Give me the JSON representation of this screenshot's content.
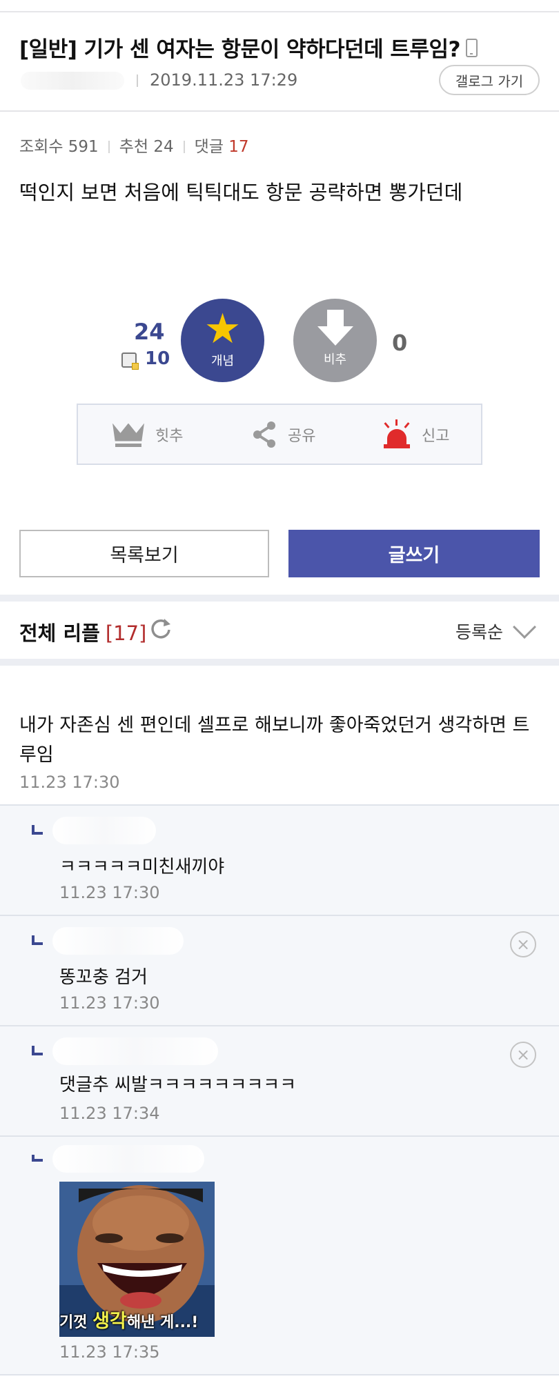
{
  "post": {
    "title": "[일반] 기가 센 여자는 항문이 약하다던데 트루임?",
    "date": "2019.11.23 17:29",
    "gallog_button": "갤로그 가기",
    "views_label": "조회수 591",
    "recommend_label": "추천 24",
    "comments_label": "댓글",
    "comments_count": "17",
    "body": "떡인지 보면 처음에 틱틱대도 항문 공략하면 뽕가던데"
  },
  "votes": {
    "up_count": "24",
    "fix_count": "10",
    "up_label": "개념",
    "down_label": "비추",
    "down_count": "0"
  },
  "actions": {
    "hit": "힛추",
    "share": "공유",
    "report": "신고"
  },
  "buttons": {
    "list": "목록보기",
    "write": "글쓰기"
  },
  "replies_header": {
    "title": "전체 리플",
    "count": "[17]",
    "sort": "등록순"
  },
  "comment": {
    "text": "내가 자존심 센 편인데 셀프로 해보니까 좋아죽었던거 생각하면 트루임",
    "date": "11.23 17:30"
  },
  "replies": [
    {
      "text": "ㅋㅋㅋㅋㅋ미친새끼야",
      "date": "11.23 17:30"
    },
    {
      "text": "똥꼬충 검거",
      "date": "11.23 17:30",
      "delete_icon": "×"
    },
    {
      "text": "댓글추 씨발ㅋㅋㅋㅋㅋㅋㅋㅋㅋ",
      "date": "11.23 17:34",
      "delete_icon": "×"
    },
    {
      "image_caption_a": "기껏 ",
      "image_caption_b": "생각",
      "image_caption_c": "해낸 게...!",
      "date": "11.23 17:35"
    }
  ],
  "icons": {
    "star": "★",
    "refresh": "refresh-icon",
    "mobile": "mobile-icon",
    "crown": "crown-icon",
    "share": "share-icon",
    "siren": "siren-icon"
  },
  "colors": {
    "accent": "#3b4890",
    "write_button": "#4b55aa",
    "count_red": "#c0392b",
    "reply_bg": "#f5f7fa"
  }
}
